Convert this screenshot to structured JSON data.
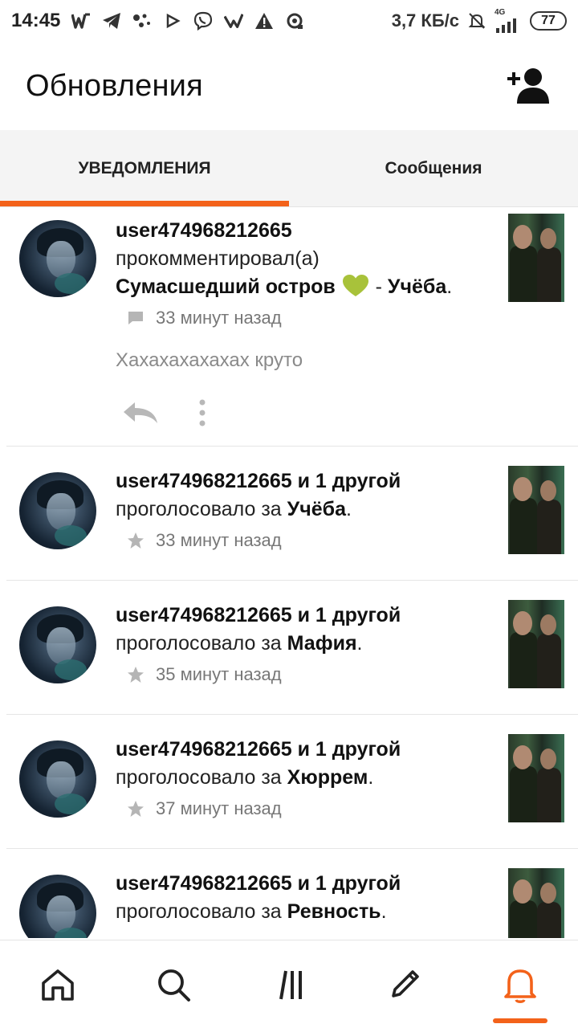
{
  "status_bar": {
    "time": "14:45",
    "speed": "3,7 КБ/с",
    "network": "4G",
    "battery": "77",
    "icons": [
      "w-icon",
      "telegram-icon",
      "dots-icon",
      "play-icon",
      "viber-icon",
      "vk-icon",
      "warning-icon",
      "sync-icon",
      "mute-icon",
      "signal-icon"
    ]
  },
  "header": {
    "title": "Обновления",
    "add_friend_icon": "add-user-icon"
  },
  "tabs": [
    {
      "label": "УВЕДОМЛЕНИЯ",
      "active": true
    },
    {
      "label": "Сообщения",
      "active": false
    }
  ],
  "colors": {
    "accent": "#f3621a",
    "heart": "#a8c23a"
  },
  "feed": {
    "items": [
      {
        "user": "user474968212665",
        "action": "прокомментировал(а)",
        "story": "Сумасшедший остров",
        "separator": " - ",
        "chapter": "Учёба",
        "period": ".",
        "meta_icon": "comment-icon",
        "time": "33 минут назад",
        "comment": "Хахахахахахах круто"
      },
      {
        "user": "user474968212665 и 1 другой",
        "action": "проголосовало за",
        "target": "Учёба",
        "period": ".",
        "meta_icon": "star-icon",
        "time": "33 минут назад"
      },
      {
        "user": "user474968212665 и 1 другой",
        "action": "проголосовало за",
        "target": "Мафия",
        "period": ".",
        "meta_icon": "star-icon",
        "time": "35 минут назад"
      },
      {
        "user": "user474968212665 и 1 другой",
        "action": "проголосовало за",
        "target": "Хюррем",
        "period": ".",
        "meta_icon": "star-icon",
        "time": "37 минут назад"
      },
      {
        "user": "user474968212665 и 1 другой",
        "action": "проголосовало за",
        "target": "Ревность",
        "period": "."
      }
    ]
  },
  "bottom_nav": [
    {
      "icon": "home-icon",
      "active": false
    },
    {
      "icon": "search-icon",
      "active": false
    },
    {
      "icon": "library-icon",
      "active": false
    },
    {
      "icon": "write-icon",
      "active": false
    },
    {
      "icon": "notifications-icon",
      "active": true
    }
  ]
}
